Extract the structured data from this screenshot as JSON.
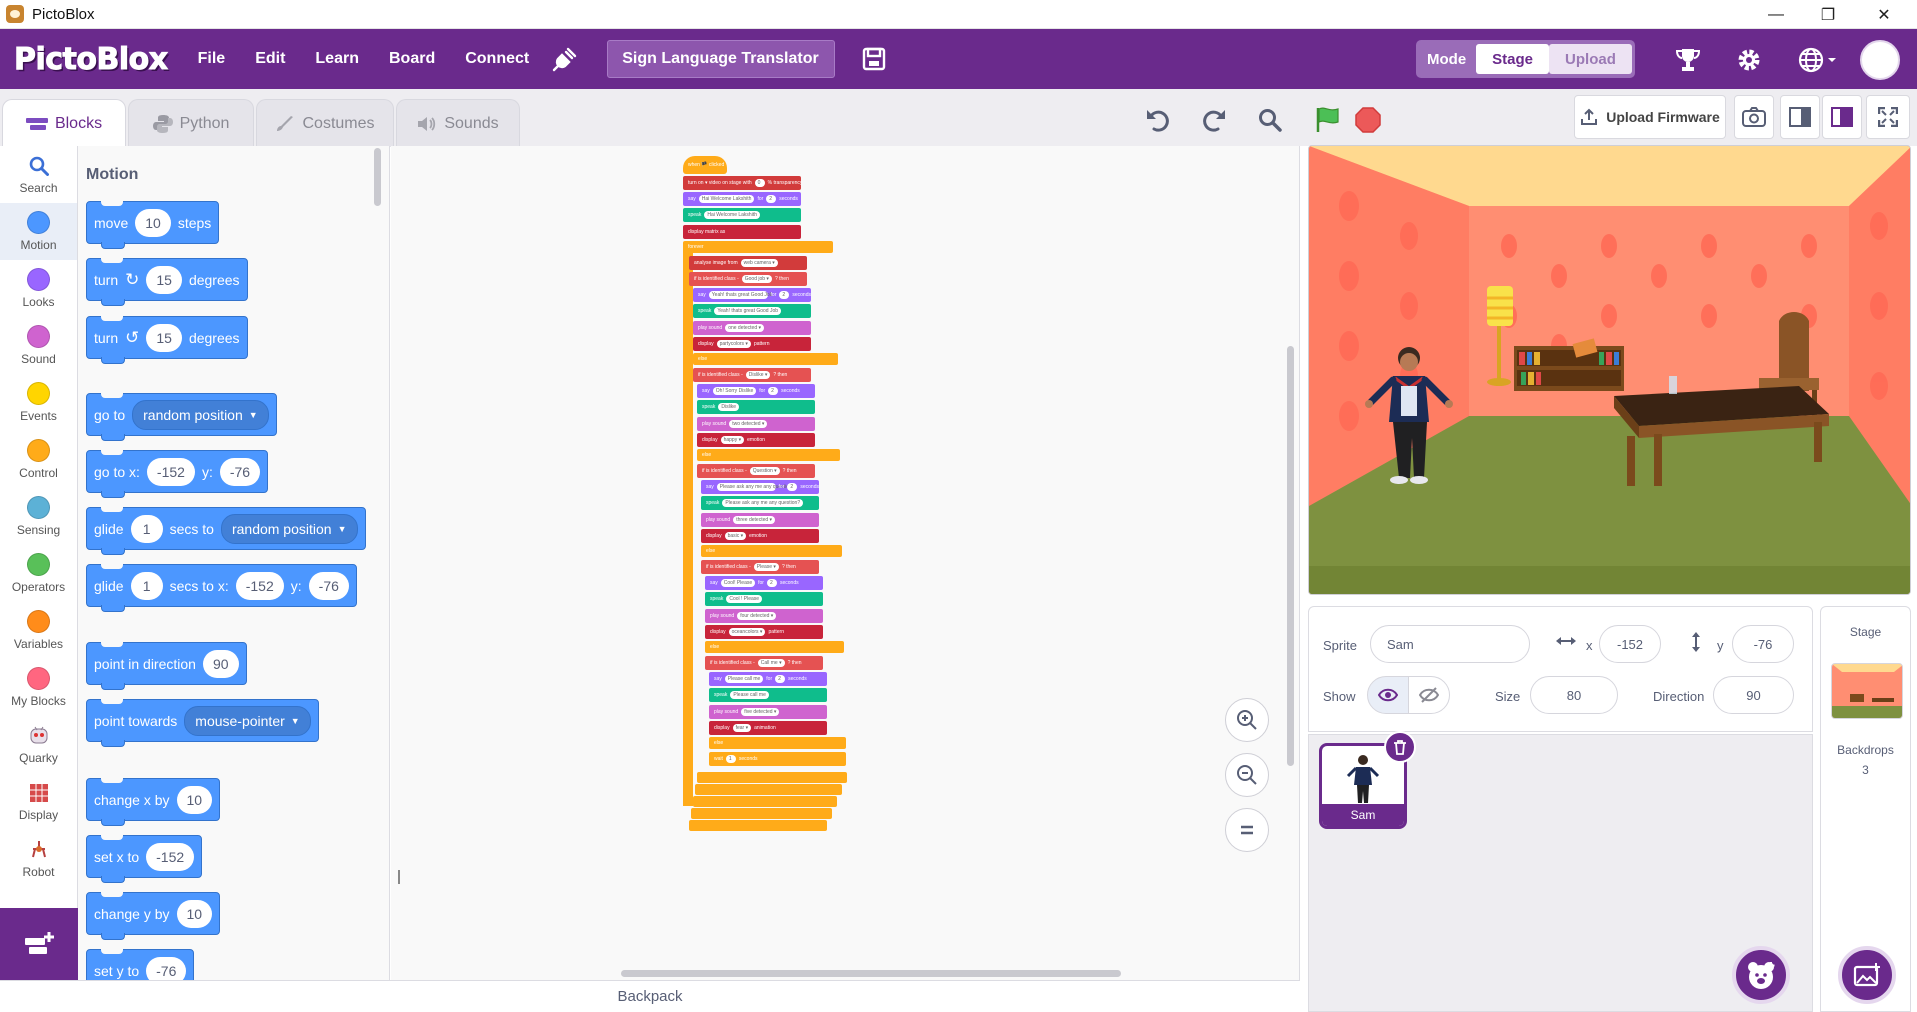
{
  "window": {
    "title": "PictoBlox",
    "controls": [
      "—",
      "❐",
      "✕"
    ]
  },
  "menubar": {
    "logo": "PictoBlox",
    "items": [
      "File",
      "Edit",
      "Learn",
      "Board",
      "Connect"
    ],
    "project_title": "Sign Language Translator",
    "mode_label": "Mode",
    "mode_stage": "Stage",
    "mode_upload": "Upload"
  },
  "tabs": {
    "blocks": "Blocks",
    "python": "Python",
    "costumes": "Costumes",
    "sounds": "Sounds",
    "upload_firmware": "Upload Firmware"
  },
  "categories": [
    {
      "label": "Search",
      "icon": "search-icon"
    },
    {
      "label": "Motion",
      "color": "#4c97ff"
    },
    {
      "label": "Looks",
      "color": "#9966ff"
    },
    {
      "label": "Sound",
      "color": "#cf63cf"
    },
    {
      "label": "Events",
      "color": "#ffd500"
    },
    {
      "label": "Control",
      "color": "#ffab19"
    },
    {
      "label": "Sensing",
      "color": "#5cb1d6"
    },
    {
      "label": "Operators",
      "color": "#59c059"
    },
    {
      "label": "Variables",
      "color": "#ff8c1a"
    },
    {
      "label": "My Blocks",
      "color": "#ff6680"
    },
    {
      "label": "Quarky",
      "icon": "quarky-icon"
    },
    {
      "label": "Display",
      "icon": "display-icon"
    },
    {
      "label": "Robot",
      "icon": "robot-icon"
    }
  ],
  "palette": {
    "heading": "Motion",
    "move": {
      "pre": "move",
      "val": "10",
      "post": "steps"
    },
    "turn_right": {
      "pre": "turn",
      "val": "15",
      "post": "degrees"
    },
    "turn_left": {
      "pre": "turn",
      "val": "15",
      "post": "degrees"
    },
    "goto": {
      "pre": "go to",
      "dd": "random position"
    },
    "goto_xy": {
      "pre": "go to x:",
      "x": "-152",
      "mid": "y:",
      "y": "-76"
    },
    "glide_to": {
      "pre": "glide",
      "val": "1",
      "mid": "secs to",
      "dd": "random position"
    },
    "glide_xy": {
      "pre": "glide",
      "val": "1",
      "mid": "secs to x:",
      "x": "-152",
      "mid2": "y:",
      "y": "-76"
    },
    "point_dir": {
      "pre": "point in direction",
      "val": "90"
    },
    "point_towards": {
      "pre": "point towards",
      "dd": "mouse-pointer"
    },
    "change_x": {
      "pre": "change x by",
      "val": "10"
    },
    "set_x": {
      "pre": "set x to",
      "val": "-152"
    },
    "change_y": {
      "pre": "change y by",
      "val": "10"
    },
    "set_y": {
      "pre": "set y to",
      "val": "-76"
    }
  },
  "script": {
    "hat": "when 🏴 clicked",
    "rows": [
      {
        "c": "c-ai",
        "t": "turn on ▾ video on stage with",
        "v": "0",
        "t2": "% transparency"
      },
      {
        "c": "c-look",
        "t": "say",
        "v": "Hai Welcome Lakshith",
        "t2": "for",
        "v2": "2",
        "t3": "seconds"
      },
      {
        "c": "c-tts",
        "t": "speak",
        "v": "Hai Welcome Lakshith"
      },
      {
        "c": "c-disp",
        "t": "display matrix as"
      },
      {
        "c": "c-ctrl",
        "t": "forever"
      },
      {
        "c": "c-ai",
        "t": "analyse image from",
        "v": "web camera ▾"
      },
      {
        "c": "c-hex",
        "t": "if  is identified class -",
        "v": "Good job ▾",
        "t2": "? then"
      },
      {
        "c": "c-look",
        "t": "say",
        "v": "Yeah! thats great Good Job",
        "t2": "for",
        "v2": "2",
        "t3": "seconds"
      },
      {
        "c": "c-tts",
        "t": "speak",
        "v": "Yeah! thats great Good Job"
      },
      {
        "c": "c-snd",
        "t": "play sound",
        "v": "one detected ▾"
      },
      {
        "c": "c-disp",
        "t": "display",
        "v": "partycolors ▾",
        "t2": "pattern"
      },
      {
        "c": "c-ctrl",
        "t": "else"
      },
      {
        "c": "c-hex",
        "t": "if  is identified class -",
        "v": "Dislike ▾",
        "t2": "? then"
      },
      {
        "c": "c-look",
        "t": "say",
        "v": "Oh! Sorry Dislike",
        "t2": "for",
        "v2": "2",
        "t3": "seconds"
      },
      {
        "c": "c-tts",
        "t": "speak",
        "v": "Dislike"
      },
      {
        "c": "c-snd",
        "t": "play sound",
        "v": "two detected ▾"
      },
      {
        "c": "c-disp",
        "t": "display",
        "v": "happy ▾",
        "t2": "emotion"
      },
      {
        "c": "c-ctrl",
        "t": "else"
      },
      {
        "c": "c-hex",
        "t": "if  is identified class -",
        "v": "Question ▾",
        "t2": "? then"
      },
      {
        "c": "c-look",
        "t": "say",
        "v": "Please ask any me any question?",
        "t2": "for",
        "v2": "2",
        "t3": "seconds"
      },
      {
        "c": "c-tts",
        "t": "speak",
        "v": "Please ask any me any question?"
      },
      {
        "c": "c-snd",
        "t": "play sound",
        "v": "three detected ▾"
      },
      {
        "c": "c-disp",
        "t": "display",
        "v": "basic ▾",
        "t2": "emotion"
      },
      {
        "c": "c-ctrl",
        "t": "else"
      },
      {
        "c": "c-hex",
        "t": "if  is identified class -",
        "v": "Please ▾",
        "t2": "? then"
      },
      {
        "c": "c-look",
        "t": "say",
        "v": "Cool! Please",
        "t2": "for",
        "v2": "2",
        "t3": "seconds"
      },
      {
        "c": "c-tts",
        "t": "speak",
        "v": "Cool ! Please"
      },
      {
        "c": "c-snd",
        "t": "play sound",
        "v": "four detected ▾"
      },
      {
        "c": "c-disp",
        "t": "display",
        "v": "oceancolors ▾",
        "t2": "pattern"
      },
      {
        "c": "c-ctrl",
        "t": "else"
      },
      {
        "c": "c-hex",
        "t": "if  is identified class -",
        "v": "Call me ▾",
        "t2": "? then"
      },
      {
        "c": "c-look",
        "t": "say",
        "v": "Please call me",
        "t2": "for",
        "v2": "2",
        "t3": "seconds"
      },
      {
        "c": "c-tts",
        "t": "speak",
        "v": "Please call me"
      },
      {
        "c": "c-snd",
        "t": "play sound",
        "v": "five detected ▾"
      },
      {
        "c": "c-disp",
        "t": "display",
        "v": "fear ▾",
        "t2": "animation"
      },
      {
        "c": "c-ctrl",
        "t": "else"
      },
      {
        "c": "c-ctrl",
        "t": "wait",
        "v": "1",
        "t2": "seconds"
      }
    ]
  },
  "sprite_info": {
    "sprite_label": "Sprite",
    "sprite_name": "Sam",
    "x_label": "x",
    "x_value": "-152",
    "y_label": "y",
    "y_value": "-76",
    "show_label": "Show",
    "size_label": "Size",
    "size_value": "80",
    "direction_label": "Direction",
    "direction_value": "90",
    "tile_name": "Sam"
  },
  "stage_panel": {
    "heading": "Stage",
    "backdrops_label": "Backdrops",
    "backdrops_count": "3"
  },
  "backpack": "Backpack"
}
